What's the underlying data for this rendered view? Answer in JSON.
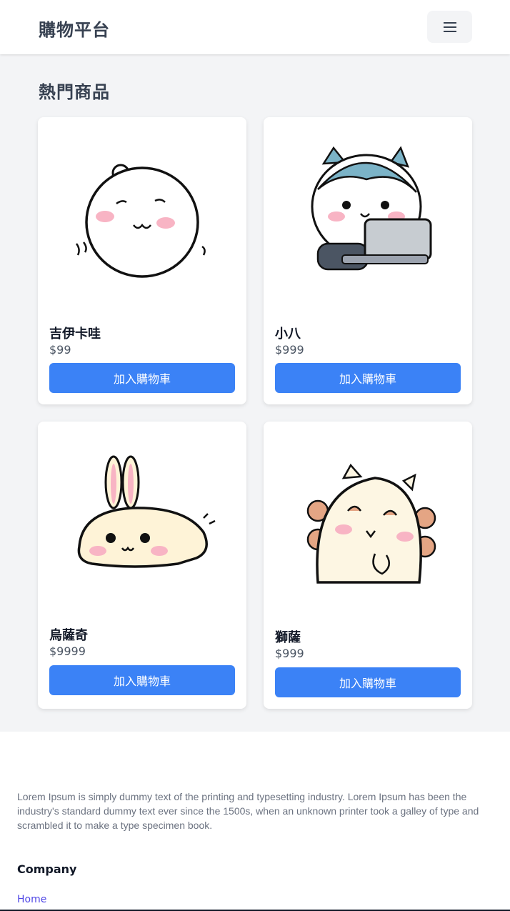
{
  "header": {
    "brand": "購物平台",
    "menu_icon": "hamburger-menu-icon"
  },
  "section": {
    "title": "熱門商品"
  },
  "products": [
    {
      "name": "吉伊卡哇",
      "price": "$99",
      "button_label": "加入購物車",
      "image": "white-bear-character"
    },
    {
      "name": "小八",
      "price": "$999",
      "button_label": "加入購物車",
      "image": "cat-with-laptop-character"
    },
    {
      "name": "烏薩奇",
      "price": "$9999",
      "button_label": "加入購物車",
      "image": "bunny-character"
    },
    {
      "name": "獅薩",
      "price": "$999",
      "button_label": "加入購物車",
      "image": "lion-character"
    }
  ],
  "footer": {
    "description": "Lorem Ipsum is simply dummy text of the printing and typesetting industry. Lorem Ipsum has been the industry's standard dummy text ever since the 1500s, when an unknown printer took a galley of type and scrambled it to make a type specimen book.",
    "company_heading": "Company",
    "home_link": "Home"
  },
  "colors": {
    "primary": "#3b82f6",
    "link": "#4f46e5",
    "background": "#f3f4f6"
  }
}
